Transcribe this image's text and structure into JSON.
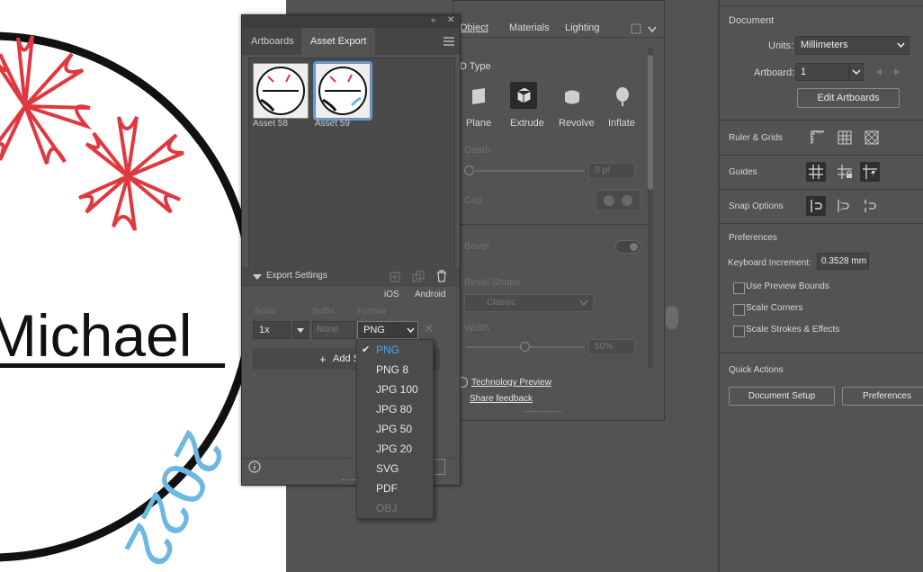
{
  "artwork": {
    "name_text": "Michael",
    "year_text": "2022"
  },
  "panel3d": {
    "tabs": [
      "Object",
      "Materials",
      "Lighting"
    ],
    "section_3d_type": "D Type",
    "types": [
      "Plane",
      "Extrude",
      "Revolve",
      "Inflate"
    ],
    "depth_label": "Depth",
    "depth_value": "0 pt",
    "cap_label": "Cap",
    "bevel_label": "Bevel",
    "bevel_shape_label": "Bevel Shape",
    "bevel_shape_value": "Classic",
    "width_label": "Width",
    "width_value": "50%",
    "tech_preview": "Technology Preview",
    "share_feedback": "Share feedback"
  },
  "asset_panel": {
    "tabs": [
      "Artboards",
      "Asset Export"
    ],
    "assets": [
      {
        "label": "Asset 58"
      },
      {
        "label": "Asset 59"
      }
    ],
    "export_settings_label": "Export Settings",
    "ios_label": "iOS",
    "android_label": "Android",
    "scale_header": "Scale",
    "suffix_header": "Suffix",
    "format_header": "Format",
    "scale_value": "1x",
    "suffix_placeholder": "None",
    "format_value": "PNG",
    "add_scale_label": "Add S"
  },
  "format_dropdown": {
    "items": [
      {
        "label": "PNG",
        "state": "selected"
      },
      {
        "label": "PNG 8",
        "state": "normal"
      },
      {
        "label": "JPG 100",
        "state": "normal"
      },
      {
        "label": "JPG 80",
        "state": "normal"
      },
      {
        "label": "JPG 50",
        "state": "normal"
      },
      {
        "label": "JPG 20",
        "state": "normal"
      },
      {
        "label": "SVG",
        "state": "normal"
      },
      {
        "label": "PDF",
        "state": "normal"
      },
      {
        "label": "OBJ",
        "state": "disabled"
      }
    ]
  },
  "properties": {
    "document_header": "Document",
    "units_label": "Units:",
    "units_value": "Millimeters",
    "artboard_label": "Artboard:",
    "artboard_value": "1",
    "edit_artboards": "Edit Artboards",
    "ruler_grids": "Ruler & Grids",
    "guides": "Guides",
    "snap_options": "Snap Options",
    "preferences_header": "Preferences",
    "keyboard_increment_label": "Keyboard Increment:",
    "keyboard_increment_value": "0.3528 mm",
    "checkboxes": [
      "Use Preview Bounds",
      "Scale Corners",
      "Scale Strokes & Effects"
    ],
    "quick_actions": "Quick Actions",
    "document_setup": "Document Setup",
    "preferences_button": "Preferences"
  },
  "colors": {
    "flower_red": "#e0383e",
    "year_blue": "#6cb8e2",
    "accent_blue": "#4aa3ff",
    "panel_bg": "#535353"
  }
}
